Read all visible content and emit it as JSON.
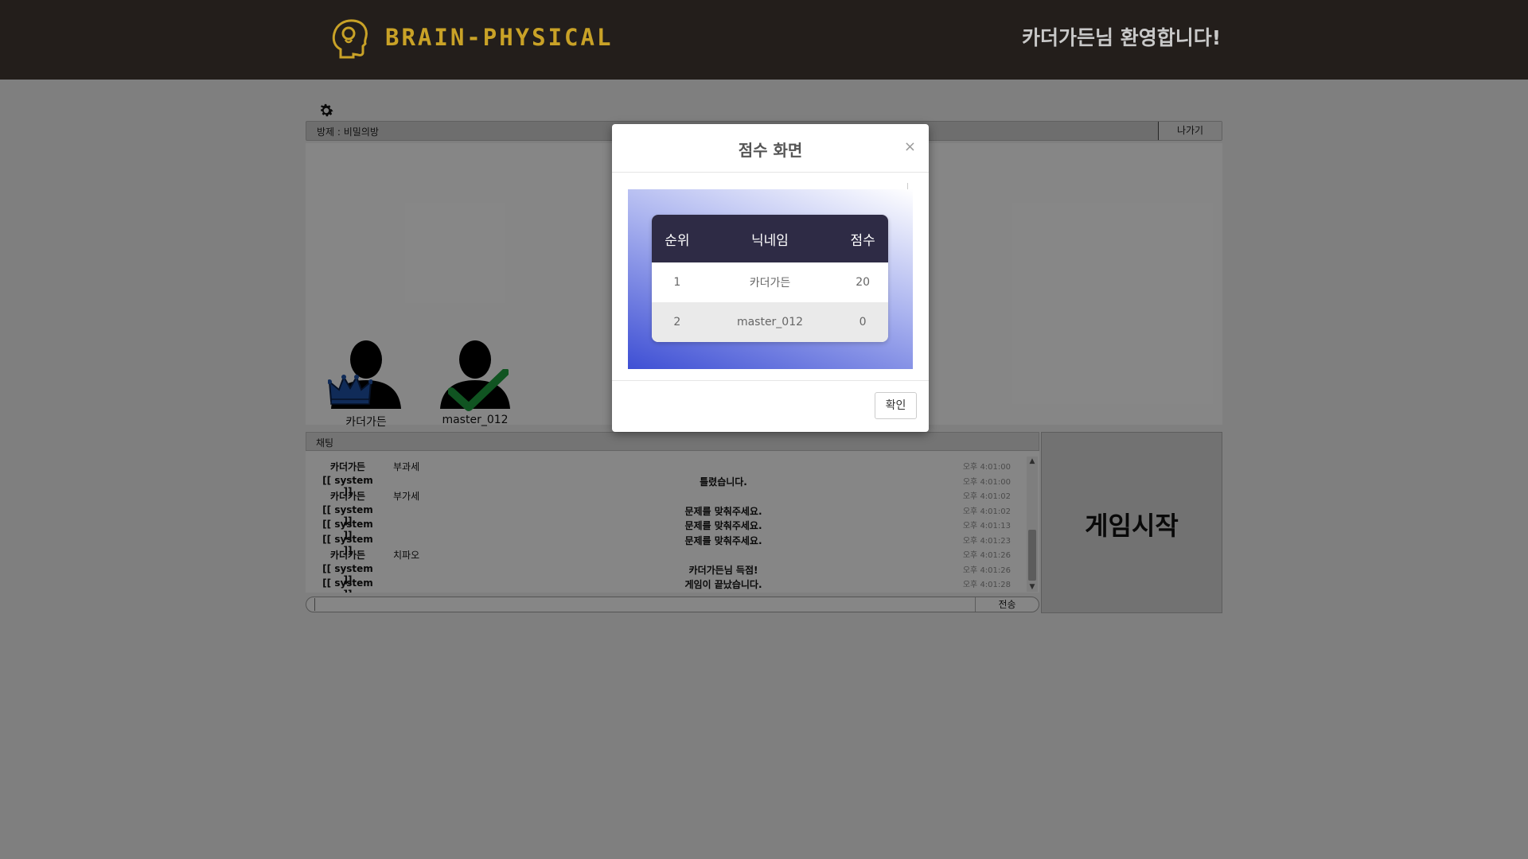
{
  "header": {
    "logo_text": "BRAIN-PHYSICAL",
    "welcome": "카더가든님 환영합니다!"
  },
  "room": {
    "title": "방제 : 비밀의방",
    "exit_label": "나가기"
  },
  "players": [
    {
      "name": "카더가든",
      "badge": "crown-icon"
    },
    {
      "name": "master_012",
      "badge": "check-icon"
    }
  ],
  "chat": {
    "header": "채팅",
    "rows": [
      {
        "who": "카더가든",
        "msg": "부과세",
        "type": "user",
        "time": "오후 4:01:00"
      },
      {
        "who": "[[ system ]]",
        "msg": "틀렸습니다.",
        "type": "system",
        "time": "오후 4:01:00"
      },
      {
        "who": "카더가든",
        "msg": "부가세",
        "type": "user",
        "time": "오후 4:01:02"
      },
      {
        "who": "[[ system ]]",
        "msg": "문제를 맞춰주세요.",
        "type": "system",
        "time": "오후 4:01:02"
      },
      {
        "who": "[[ system ]]",
        "msg": "문제를 맞춰주세요.",
        "type": "system",
        "time": "오후 4:01:13"
      },
      {
        "who": "[[ system ]]",
        "msg": "문제를 맞춰주세요.",
        "type": "system",
        "time": "오후 4:01:23"
      },
      {
        "who": "카더가든",
        "msg": "치파오",
        "type": "user",
        "time": "오후 4:01:26"
      },
      {
        "who": "[[ system ]]",
        "msg": "카더가든님 득점!",
        "type": "system",
        "time": "오후 4:01:26"
      },
      {
        "who": "[[ system ]]",
        "msg": "게임이 끝났습니다.",
        "type": "system",
        "time": "오후 4:01:28"
      }
    ],
    "input_value": "",
    "send_label": "전송"
  },
  "start_label": "게임시작",
  "modal": {
    "title": "점수 화면",
    "close": "×",
    "columns": [
      "순위",
      "닉네임",
      "점수"
    ],
    "rows": [
      {
        "rank": "1",
        "nickname": "카더가든",
        "score": "20"
      },
      {
        "rank": "2",
        "nickname": "master_012",
        "score": "0"
      }
    ],
    "ok_label": "확인"
  },
  "colors": {
    "header_bg": "#231e1b",
    "logo_gold": "#c9a227",
    "table_header": "#2e2b45",
    "gradient_blue": "#3e4fd4"
  }
}
